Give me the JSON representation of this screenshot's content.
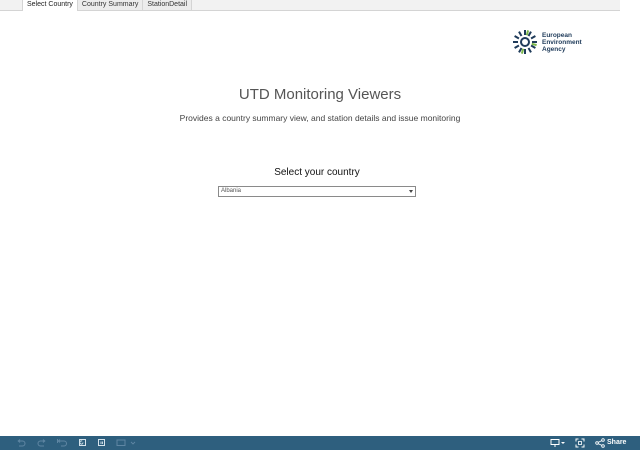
{
  "tabs": [
    {
      "label": "Select Country",
      "active": true
    },
    {
      "label": "Country Summary",
      "active": false
    },
    {
      "label": "StationDetail",
      "active": false
    }
  ],
  "logo": {
    "line1": "European",
    "line2": "Environment",
    "line3": "Agency",
    "icon": "eea-sun-logo-icon",
    "colors": {
      "dark": "#1f3b5a",
      "green": "#7ab648"
    }
  },
  "main": {
    "title": "UTD Monitoring Viewers",
    "subtitle": "Provides a country summary view, and station details and issue monitoring",
    "select_label": "Select  your country",
    "country_select": {
      "value": "Albania"
    }
  },
  "toolbar": {
    "background": "#2e5f7e",
    "left_icons": [
      "undo-icon",
      "redo-icon",
      "revert-icon",
      "refresh-icon",
      "pause-icon",
      "subscribe-icon"
    ],
    "right_icons": [
      "comment-icon",
      "fullscreen-icon",
      "share-icon"
    ],
    "share_label": "Share"
  }
}
